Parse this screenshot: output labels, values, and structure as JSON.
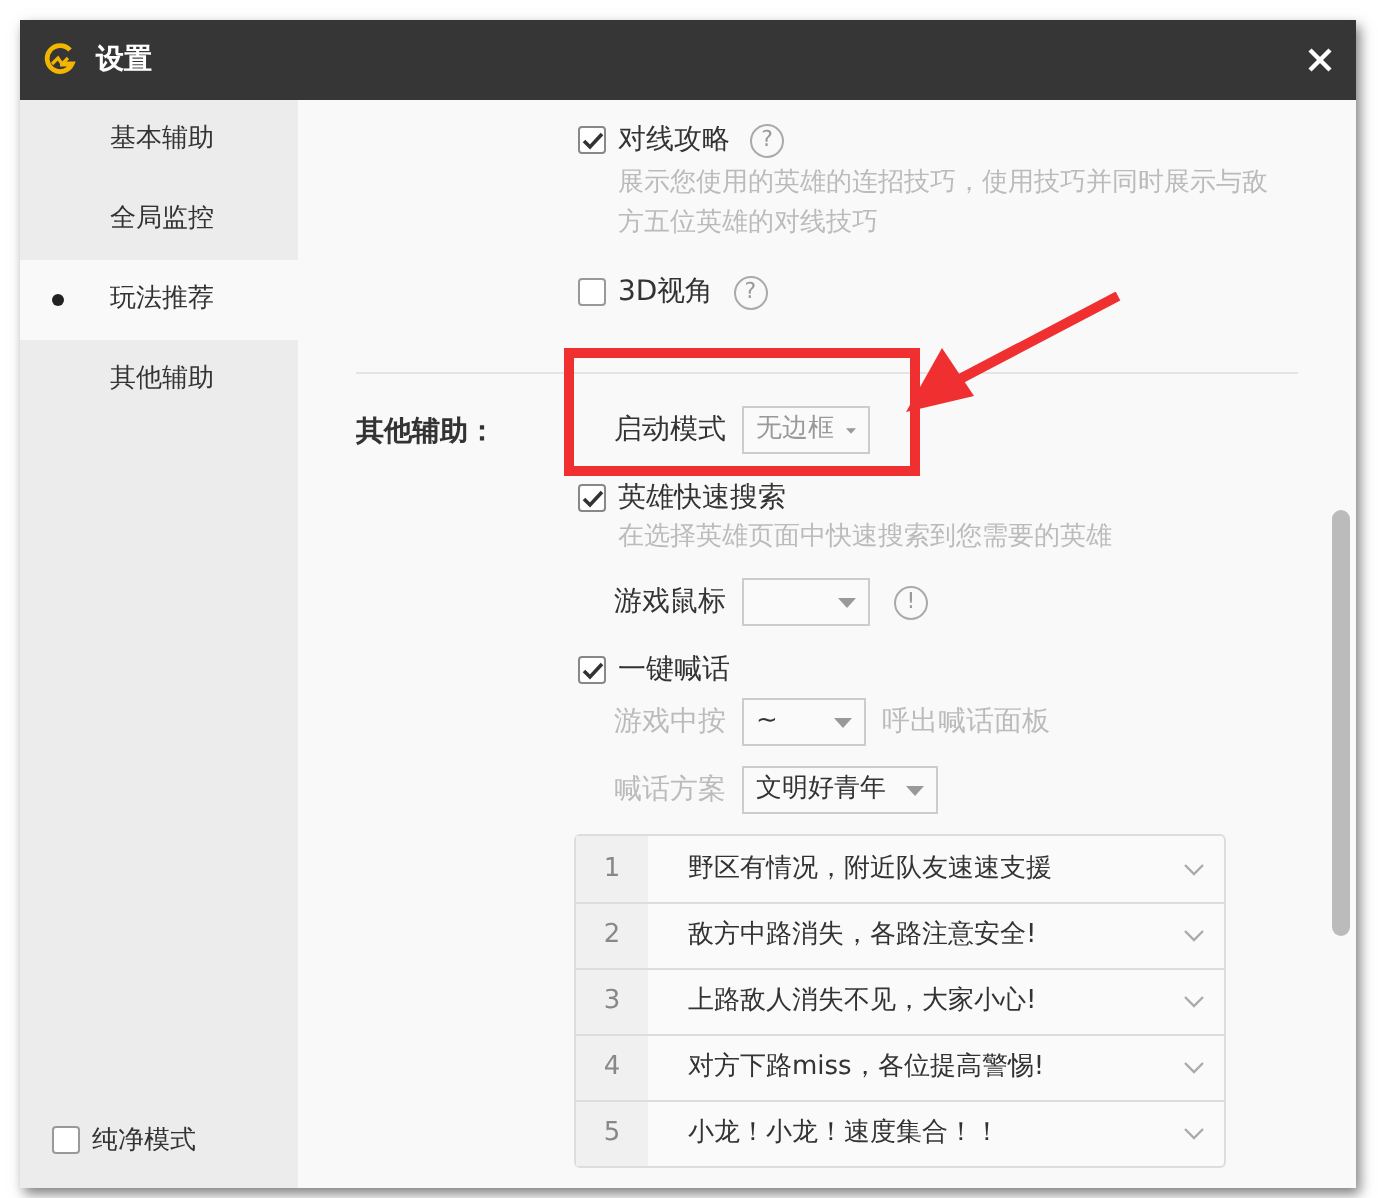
{
  "window": {
    "title": "设置"
  },
  "sidebar": {
    "items": [
      {
        "label": "基本辅助",
        "selected": false
      },
      {
        "label": "全局监控",
        "selected": false
      },
      {
        "label": "玩法推荐",
        "selected": true
      },
      {
        "label": "其他辅助",
        "selected": false
      }
    ],
    "pure_mode": {
      "label": "纯净模式",
      "checked": false
    }
  },
  "top_options": [
    {
      "label": "对线攻略",
      "checked": true,
      "help": "?",
      "description": "展示您使用的英雄的连招技巧，使用技巧并同时展示与敌方五位英雄的对线技巧"
    },
    {
      "label": "3D视角",
      "checked": false,
      "help": "?"
    }
  ],
  "other": {
    "heading": "其他辅助：",
    "launch_mode": {
      "label": "启动模式",
      "value": "无边框",
      "disabled": true
    },
    "hero_search": {
      "label": "英雄快速搜索",
      "checked": true,
      "description": "在选择英雄页面中快速搜索到您需要的英雄"
    },
    "game_mouse": {
      "label": "游戏鼠标",
      "warning": "!"
    },
    "shout": {
      "label": "一键喊话",
      "checked": true,
      "hotkey_prefix": "游戏中按",
      "hotkey": "~",
      "hotkey_suffix": "呼出喊话面板",
      "scheme_label": "喊话方案",
      "scheme": "文明好青年",
      "phrases": [
        {
          "number": "1",
          "text": "野区有情况，附近队友速速支援"
        },
        {
          "number": "2",
          "text": "敌方中路消失，各路注意安全!"
        },
        {
          "number": "3",
          "text": "上路敌人消失不见，大家小心!"
        },
        {
          "number": "4",
          "text": "对方下路miss，各位提高警惕!"
        },
        {
          "number": "5",
          "text": "小龙！小龙！速度集合！！"
        }
      ]
    }
  }
}
